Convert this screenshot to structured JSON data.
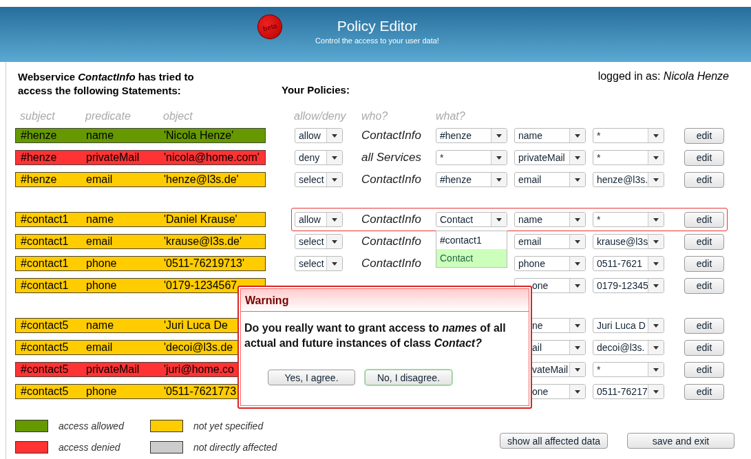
{
  "header": {
    "badge": "beta",
    "title": "Policy Editor",
    "subtitle": "Control the access to your user data!"
  },
  "statements_title": "Webservice *ContactInfo* has tried to access the following Statements:",
  "policies_title": "Your Policies:",
  "user": {
    "label": "logged in as:",
    "name": "Nicola Henze"
  },
  "statement_columns": [
    "subject",
    "predicate",
    "object"
  ],
  "policy_columns": [
    "allow/deny",
    "who?",
    "what?"
  ],
  "groups": [
    {
      "rows": [
        {
          "subject": "#henze",
          "predicate": "name",
          "object": "'Nicola Henze'",
          "color": "#669900",
          "permission": "allow",
          "who": "ContactInfo",
          "what_subject": "#henze",
          "what_predicate": "name",
          "what_object": "*",
          "edit": "edit",
          "highlighted": false,
          "covered": false
        },
        {
          "subject": "#henze",
          "predicate": "privateMail",
          "object": "'nicola@home.com'",
          "color": "#ff3333",
          "permission": "deny",
          "who": "all Services",
          "what_subject": "*",
          "what_predicate": "privateMail",
          "what_object": "*",
          "edit": "edit",
          "highlighted": false,
          "covered": false
        },
        {
          "subject": "#henze",
          "predicate": "email",
          "object": "'henze@l3s.de'",
          "color": "#ffcc00",
          "permission": "select",
          "who": "ContactInfo",
          "what_subject": "#henze",
          "what_predicate": "email",
          "what_object": "henze@l3s.",
          "edit": "edit",
          "highlighted": false,
          "covered": false
        }
      ]
    },
    {
      "rows": [
        {
          "subject": "#contact1",
          "predicate": "name",
          "object": "'Daniel Krause'",
          "color": "#ffcc00",
          "permission": "allow",
          "who": "ContactInfo",
          "what_subject": "Contact",
          "what_predicate": "name",
          "what_object": "*",
          "edit": "edit",
          "highlighted": true,
          "covered": false,
          "dropdown": {
            "options": [
              {
                "label": "#contact1",
                "selected": false
              },
              {
                "label": "Contact",
                "selected": true
              }
            ]
          }
        },
        {
          "subject": "#contact1",
          "predicate": "email",
          "object": "'krause@l3s.de'",
          "color": "#ffcc00",
          "permission": "select",
          "who": "ContactInfo",
          "what_predicate": "email",
          "what_object": "krause@l3s",
          "edit": "edit",
          "highlighted": false,
          "covered": false
        },
        {
          "subject": "#contact1",
          "predicate": "phone",
          "object": "'0511-76219713'",
          "color": "#ffcc00",
          "permission": "select",
          "who": "ContactInfo",
          "what_predicate": "phone",
          "what_object": "0511-7621",
          "edit": "edit",
          "highlighted": false,
          "covered": false
        },
        {
          "subject": "#contact1",
          "predicate": "phone",
          "object": "'0179-1234567",
          "color": "#ffcc00",
          "what_predicate": "one",
          "what_object": "0179-12345",
          "edit": "edit",
          "highlighted": false,
          "covered": true
        }
      ]
    },
    {
      "rows": [
        {
          "subject": "#contact5",
          "predicate": "name",
          "object": "'Juri Luca De",
          "color": "#ffcc00",
          "what_predicate": "ne",
          "what_object": "Juri Luca D",
          "edit": "edit",
          "highlighted": false,
          "covered": true
        },
        {
          "subject": "#contact5",
          "predicate": "email",
          "object": "'decoi@l3s.de",
          "color": "#ffcc00",
          "what_predicate": "ail",
          "what_object": "decoi@l3s.",
          "edit": "edit",
          "highlighted": false,
          "covered": true
        },
        {
          "subject": "#contact5",
          "predicate": "privateMail",
          "object": "'juri@home.co",
          "color": "#ff3333",
          "what_predicate": "vateMail",
          "what_object": "*",
          "edit": "edit",
          "highlighted": false,
          "covered": true
        },
        {
          "subject": "#contact5",
          "predicate": "phone",
          "object": "'0511-7621773",
          "color": "#ffcc00",
          "what_predicate": "one",
          "what_object": "0511-76217",
          "edit": "edit",
          "highlighted": false,
          "covered": true
        }
      ]
    }
  ],
  "legend": [
    {
      "color": "#669900",
      "label": "access allowed"
    },
    {
      "color": "#ffcc00",
      "label": "not yet specified"
    },
    {
      "color": "#ff3333",
      "label": "access denied"
    },
    {
      "color": "#cccccc",
      "label": "not directly affected"
    }
  ],
  "buttons": [
    "show all affected data",
    "save and exit"
  ],
  "dialog": {
    "title": "Warning",
    "message": "Do you really want to grant access to *names* of  all actual and future instances of class *Contact?*",
    "buttons": [
      {
        "label": "Yes, I agree.",
        "focused": false
      },
      {
        "label": "No, I disagree.",
        "focused": true
      }
    ]
  }
}
